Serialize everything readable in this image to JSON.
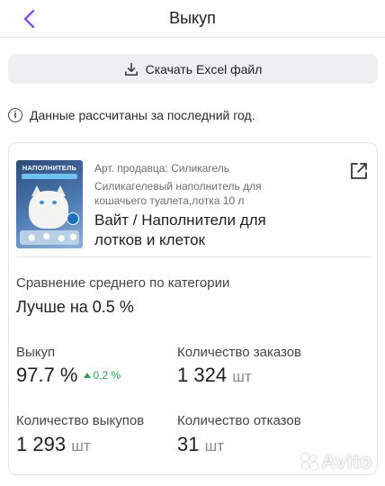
{
  "header": {
    "title": "Выкуп",
    "back_icon": "chevron-left-icon"
  },
  "excel_button": {
    "label": "Скачать Excel файл",
    "icon": "download-icon"
  },
  "info": {
    "text": "Данные рассчитаны за последний год.",
    "icon": "info-icon"
  },
  "product": {
    "image_text": "НАПОЛНИТЕЛЬ",
    "vendor_code": "Арт. продавца: Силикагель",
    "description": "Силикагелевый наполнитель для кошачьего туалета,лотка 10 л",
    "name": "Вайт / Наполнители для лотков и клеток",
    "link_icon": "external-link-icon"
  },
  "comparison": {
    "label": "Сравнение среднего по категории",
    "value": "Лучше на 0.5 %"
  },
  "metrics": {
    "buyout": {
      "label": "Выкуп",
      "value": "97.7 %",
      "delta": "0,2 %"
    },
    "orders": {
      "label": "Количество заказов",
      "value": "1 324",
      "unit": "шт"
    },
    "buyouts_count": {
      "label": "Количество выкупов",
      "value": "1 293",
      "unit": "шт"
    },
    "refusals": {
      "label": "Количество отказов",
      "value": "31",
      "unit": "шт"
    }
  },
  "watermark": "Avito",
  "colors": {
    "accent": "#7b3fe4",
    "positive": "#2e9e5b",
    "button_bg": "#efeff1"
  }
}
